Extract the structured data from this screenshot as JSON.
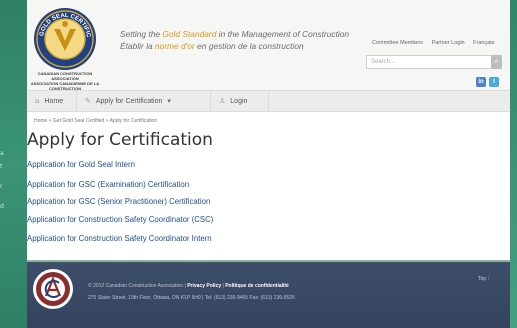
{
  "left_sidebar": {
    "letters": [
      "a",
      "t",
      "r",
      "d"
    ]
  },
  "header": {
    "logo": {
      "ring_text": "GOLD SEAL CERTIFICATION",
      "caption_lines": [
        "CANADIAN CONSTRUCTION",
        "ASSOCIATION",
        "ASSOCIATION CANADIENNE DE LA CONSTRUCTION"
      ]
    },
    "tagline_en": {
      "before": "Setting the ",
      "highlight": "Gold Standard",
      "after": " in the Management of Construction"
    },
    "tagline_fr": {
      "before": "Établir la ",
      "highlight": "norme d'or",
      "after": " en gestion de la construction"
    },
    "top_links": [
      "Committee Members",
      "Partner Login",
      "Français"
    ],
    "search": {
      "placeholder": "Search..."
    },
    "social": {
      "linkedin": "in",
      "twitter": "t"
    }
  },
  "nav": {
    "items": [
      {
        "label": "Home",
        "icon": "home-icon"
      },
      {
        "label": "Apply for Certification",
        "icon": "pencil-icon"
      },
      {
        "label": "Login",
        "icon": "user-icon"
      }
    ]
  },
  "breadcrumb": "Home » Get Gold Seal Certified » Apply for Certification",
  "page": {
    "title": "Apply for Certification",
    "links": [
      "Application for Gold Seal Intern",
      "Application for GSC (Examination) Certification",
      "Application for GSC (Senior Practitioner) Certification",
      "Application for Construction Safety Coordinator (CSC)",
      "Application for Construction Safety Coordinator Intern"
    ]
  },
  "footer": {
    "copyright": "© 2012 Canadian Construction Association |",
    "privacy": "Privacy Policy",
    "sep": " | ",
    "privacy_fr": "Politique de confidentialité",
    "address": "275 Slater Street, 19th Floor, Ottawa, ON K1P 5H9 | Tel: (613) 236-9455 Fax: (613) 236-9526",
    "top_link": "Top ↑"
  },
  "colors": {
    "gold": "#d69a19",
    "link": "#1f4f8e",
    "footer": "#3a4a65",
    "green": "#3f9477"
  }
}
